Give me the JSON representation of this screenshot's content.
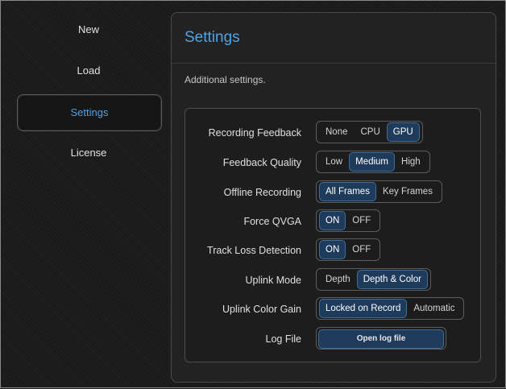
{
  "sidebar": {
    "items": [
      {
        "label": "New"
      },
      {
        "label": "Load"
      },
      {
        "label": "Settings",
        "active": true
      },
      {
        "label": "License"
      }
    ]
  },
  "panel": {
    "title": "Settings",
    "description": "Additional settings."
  },
  "settings": {
    "recording_feedback": {
      "label": "Recording Feedback",
      "options": [
        "None",
        "CPU",
        "GPU"
      ],
      "selected": "GPU"
    },
    "feedback_quality": {
      "label": "Feedback Quality",
      "options": [
        "Low",
        "Medium",
        "High"
      ],
      "selected": "Medium"
    },
    "offline_recording": {
      "label": "Offline Recording",
      "options": [
        "All Frames",
        "Key Frames"
      ],
      "selected": "All Frames"
    },
    "force_qvga": {
      "label": "Force QVGA",
      "options": [
        "ON",
        "OFF"
      ],
      "selected": "ON"
    },
    "track_loss_detection": {
      "label": "Track Loss Detection",
      "options": [
        "ON",
        "OFF"
      ],
      "selected": "ON"
    },
    "uplink_mode": {
      "label": "Uplink Mode",
      "options": [
        "Depth",
        "Depth & Color"
      ],
      "selected": "Depth & Color"
    },
    "uplink_color_gain": {
      "label": "Uplink Color Gain",
      "options": [
        "Locked on Record",
        "Automatic"
      ],
      "selected": "Locked on Record"
    },
    "log_file": {
      "label": "Log File",
      "button_label": "Open log file"
    }
  },
  "colors": {
    "accent": "#4fa3e8",
    "selected_fill": "#1f3b5c",
    "background": "#1b1b1b"
  }
}
